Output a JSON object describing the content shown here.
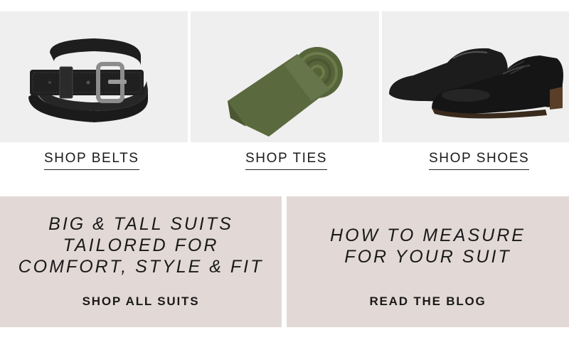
{
  "categories": [
    {
      "id": "belts",
      "link_label": "SHOP BELTS",
      "icon": "belt-image"
    },
    {
      "id": "ties",
      "link_label": "SHOP TIES",
      "icon": "tie-image"
    },
    {
      "id": "shoes",
      "link_label": "SHOP SHOES",
      "icon": "shoes-image"
    }
  ],
  "promos": {
    "suits": {
      "heading_lines": [
        "BIG & TALL SUITS",
        "TAILORED FOR",
        "COMFORT, STYLE & FIT"
      ],
      "cta_label": "SHOP ALL SUITS"
    },
    "blog": {
      "heading_lines": [
        "HOW TO MEASURE",
        "FOR YOUR SUIT"
      ],
      "cta_label": "READ THE BLOG"
    }
  },
  "colors": {
    "tile_background": "#efefef",
    "promo_background": "#e2d9d6",
    "text": "#1a1a1a",
    "tie_green": "#5b6a3e"
  }
}
